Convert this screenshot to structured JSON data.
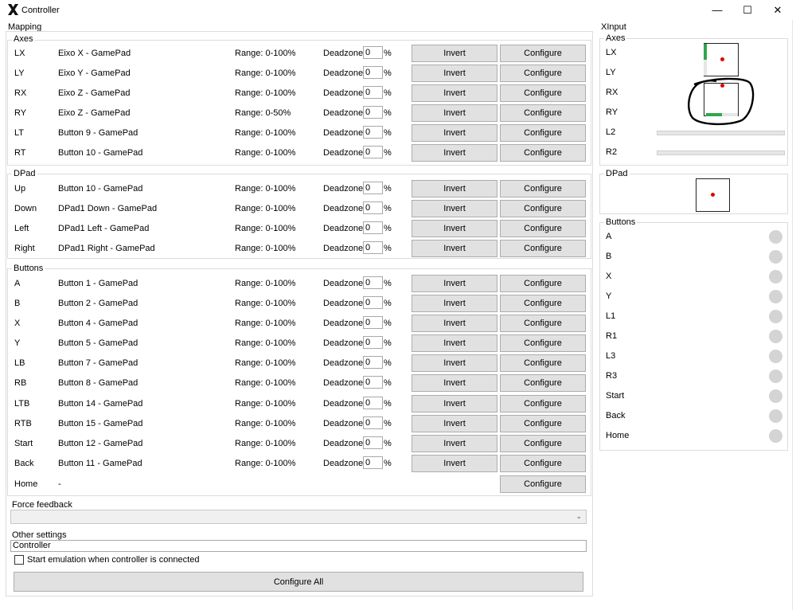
{
  "window": {
    "title": "Controller",
    "minimize_glyph": "—",
    "maximize_glyph": "☐",
    "close_glyph": "✕"
  },
  "mapping": {
    "label": "Mapping",
    "dz_label": "Deadzone:",
    "pct": "%",
    "invert_label": "Invert",
    "configure_label": "Configure",
    "axes": {
      "label": "Axes",
      "rows": [
        {
          "ctl": "LX",
          "src": "Eixo X - GamePad",
          "range": "Range: 0-100%",
          "dz": "0"
        },
        {
          "ctl": "LY",
          "src": "Eixo Y - GamePad",
          "range": "Range: 0-100%",
          "dz": "0"
        },
        {
          "ctl": "RX",
          "src": "Eixo Z - GamePad",
          "range": "Range: 0-100%",
          "dz": "0"
        },
        {
          "ctl": "RY",
          "src": "Eixo Z - GamePad",
          "range": "Range: 0-50%",
          "dz": "0"
        },
        {
          "ctl": "LT",
          "src": "Button 9 - GamePad",
          "range": "Range: 0-100%",
          "dz": "0"
        },
        {
          "ctl": "RT",
          "src": "Button 10 - GamePad",
          "range": "Range: 0-100%",
          "dz": "0"
        }
      ]
    },
    "dpad": {
      "label": "DPad",
      "rows": [
        {
          "ctl": "Up",
          "src": "Button 10 - GamePad",
          "range": "Range: 0-100%",
          "dz": "0"
        },
        {
          "ctl": "Down",
          "src": "DPad1 Down - GamePad",
          "range": "Range: 0-100%",
          "dz": "0"
        },
        {
          "ctl": "Left",
          "src": "DPad1 Left - GamePad",
          "range": "Range: 0-100%",
          "dz": "0"
        },
        {
          "ctl": "Right",
          "src": "DPad1 Right - GamePad",
          "range": "Range: 0-100%",
          "dz": "0"
        }
      ]
    },
    "buttons": {
      "label": "Buttons",
      "rows": [
        {
          "ctl": "A",
          "src": "Button 1 - GamePad",
          "range": "Range: 0-100%",
          "dz": "0"
        },
        {
          "ctl": "B",
          "src": "Button 2 - GamePad",
          "range": "Range: 0-100%",
          "dz": "0"
        },
        {
          "ctl": "X",
          "src": "Button 4 - GamePad",
          "range": "Range: 0-100%",
          "dz": "0"
        },
        {
          "ctl": "Y",
          "src": "Button 5 - GamePad",
          "range": "Range: 0-100%",
          "dz": "0"
        },
        {
          "ctl": "LB",
          "src": "Button 7 - GamePad",
          "range": "Range: 0-100%",
          "dz": "0"
        },
        {
          "ctl": "RB",
          "src": "Button 8 - GamePad",
          "range": "Range: 0-100%",
          "dz": "0"
        },
        {
          "ctl": "LTB",
          "src": "Button 14 - GamePad",
          "range": "Range: 0-100%",
          "dz": "0"
        },
        {
          "ctl": "RTB",
          "src": "Button 15 - GamePad",
          "range": "Range: 0-100%",
          "dz": "0"
        },
        {
          "ctl": "Start",
          "src": "Button 12 - GamePad",
          "range": "Range: 0-100%",
          "dz": "0"
        },
        {
          "ctl": "Back",
          "src": "Button 11 - GamePad",
          "range": "Range: 0-100%",
          "dz": "0"
        }
      ],
      "home": {
        "ctl": "Home",
        "src": "-"
      }
    },
    "force_feedback": {
      "label": "Force feedback",
      "value": ""
    },
    "other_settings": {
      "label": "Other settings",
      "name_value": "Controller",
      "start_emulation_label": "Start emulation when controller is connected",
      "start_emulation_checked": false,
      "configure_all_label": "Configure All"
    }
  },
  "xinput": {
    "label": "XInput",
    "axes_label": "Axes",
    "axes_labels": [
      "LX",
      "LY",
      "RX",
      "RY",
      "L2",
      "R2"
    ],
    "l2_level": 0,
    "r2_level": 0,
    "dpad_label": "DPad",
    "buttons_label": "Buttons",
    "buttons": [
      "A",
      "B",
      "X",
      "Y",
      "L1",
      "R1",
      "L3",
      "R3",
      "Start",
      "Back",
      "Home"
    ],
    "indicator_color": "#d4d4d4",
    "stick_dot_color": "#e00000",
    "stick_bar_color": "#2ea84a"
  }
}
